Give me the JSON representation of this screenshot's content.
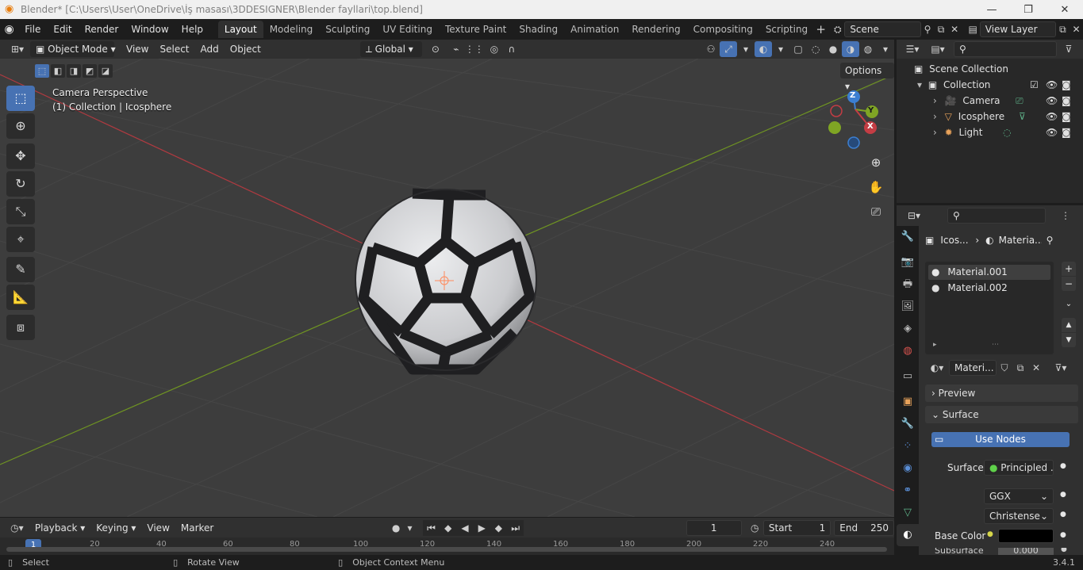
{
  "window": {
    "title": "Blender* [C:\\Users\\User\\OneDrive\\İş masası\\3DDESIGNER\\Blender fayllari\\top.blend]",
    "minimize": "—",
    "maximize": "❐",
    "close": "✕"
  },
  "menus": [
    "File",
    "Edit",
    "Render",
    "Window",
    "Help"
  ],
  "workspaces": [
    "Layout",
    "Modeling",
    "Sculpting",
    "UV Editing",
    "Texture Paint",
    "Shading",
    "Animation",
    "Rendering",
    "Compositing",
    "Scripting"
  ],
  "active_workspace": "Layout",
  "scene": {
    "name": "Scene",
    "view_layer": "View Layer"
  },
  "viewport_header": {
    "mode": "Object Mode",
    "menus": [
      "View",
      "Select",
      "Add",
      "Object"
    ],
    "orientation": "Global",
    "options": "Options"
  },
  "viewport": {
    "perspective_label": "Camera Perspective",
    "collection_label": "(1) Collection | Icosphere",
    "gizmo": {
      "z": "Z",
      "y": "Y",
      "x": "X"
    }
  },
  "timeline": {
    "menus": [
      "Playback",
      "Keying",
      "View",
      "Marker"
    ],
    "current_frame": "1",
    "start_label": "Start",
    "start": "1",
    "end_label": "End",
    "end": "250",
    "ruler": [
      "1",
      "20",
      "40",
      "60",
      "80",
      "100",
      "120",
      "140",
      "160",
      "180",
      "200",
      "220",
      "240"
    ]
  },
  "statusbar": {
    "select": "Select",
    "rotate": "Rotate View",
    "context": "Object Context Menu",
    "version": "3.4.1"
  },
  "outliner": {
    "root": "Scene Collection",
    "collection": "Collection",
    "items": [
      "Camera",
      "Icosphere",
      "Light"
    ]
  },
  "properties": {
    "breadcrumb_object": "Icos...",
    "breadcrumb_material": "Materia...",
    "material_slots": [
      "Material.001",
      "Material.002"
    ],
    "material_field": "Materi...",
    "panels": {
      "preview": "Preview",
      "surface": "Surface"
    },
    "use_nodes": "Use Nodes",
    "surface_label": "Surface",
    "surface_value": "Principled ...",
    "distribution": "GGX",
    "subsurface_method": "Christense...",
    "base_color_label": "Base Color",
    "base_color": "#000000",
    "subsurface_partial": "Subsurface",
    "subsurface_value": "0.000"
  },
  "colors": {
    "accent": "#4772b3",
    "x_axis": "#c43d44",
    "y_axis": "#7fa524",
    "z_axis": "#3c7fd1",
    "viewport_bg": "#3d3d3d"
  }
}
